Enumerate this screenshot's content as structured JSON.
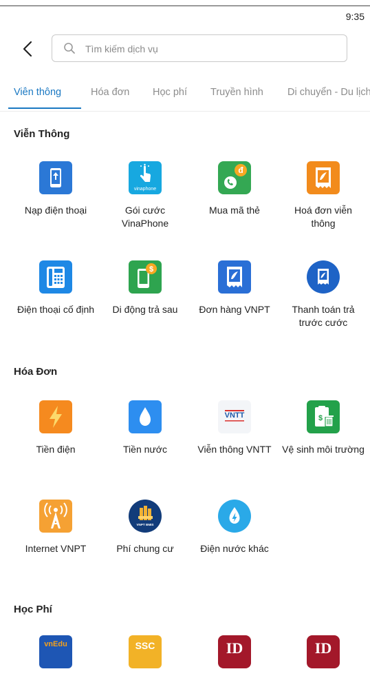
{
  "status": {
    "time": "9:35"
  },
  "search": {
    "placeholder": "Tìm kiếm dịch vụ"
  },
  "tabs": [
    {
      "label": "Viễn thông",
      "active": true
    },
    {
      "label": "Hóa đơn"
    },
    {
      "label": "Học phí"
    },
    {
      "label": "Truyền hình"
    },
    {
      "label": "Di chuyển - Du lịch"
    }
  ],
  "sections": {
    "vien_thong": {
      "title": "Viễn Thông",
      "items": [
        {
          "label": "Nạp điện thoại",
          "icon": "mobile-topup-icon"
        },
        {
          "label": "Gói cước VinaPhone",
          "icon": "vinaphone-package-icon",
          "icon_text": "vinaphone"
        },
        {
          "label": "Mua mã thẻ",
          "icon": "buy-card-code-icon",
          "icon_text": "đ"
        },
        {
          "label": "Hoá đơn viễn thông",
          "icon": "telecom-bill-icon"
        },
        {
          "label": "Điện thoại cố định",
          "icon": "landline-phone-icon"
        },
        {
          "label": "Di động trả sau",
          "icon": "postpaid-mobile-icon",
          "icon_text": "$"
        },
        {
          "label": "Đơn hàng VNPT",
          "icon": "vnpt-order-icon"
        },
        {
          "label": "Thanh toán trả trước cước",
          "icon": "prepaid-payment-icon"
        }
      ]
    },
    "hoa_don": {
      "title": "Hóa Đơn",
      "items": [
        {
          "label": "Tiền điện",
          "icon": "electricity-icon"
        },
        {
          "label": "Tiền nước",
          "icon": "water-drop-icon"
        },
        {
          "label": "Viễn thông VNTT",
          "icon": "vntt-logo-icon",
          "icon_text": "VNTT"
        },
        {
          "label": "Vệ sinh môi trường",
          "icon": "sanitation-icon",
          "icon_text": "$"
        },
        {
          "label": "Internet VNPT",
          "icon": "internet-tower-icon"
        },
        {
          "label": "Phí chung cư",
          "icon": "apartment-fee-icon",
          "icon_text": "VNPT BMIS"
        },
        {
          "label": "Điện nước khác",
          "icon": "other-utilities-icon"
        }
      ]
    },
    "hoc_phi": {
      "title": "Học Phí",
      "items": [
        {
          "label": "",
          "icon": "vnedu-icon",
          "icon_text": "vnEdu"
        },
        {
          "label": "",
          "icon": "ssc-icon",
          "icon_text": "SSC"
        },
        {
          "label": "",
          "icon": "id-school-icon",
          "icon_text": "ID"
        },
        {
          "label": "",
          "icon": "id-school-icon-2",
          "icon_text": "ID"
        }
      ]
    }
  },
  "colors": {
    "accent": "#1a78c2",
    "tab_inactive": "#8c8c8c",
    "orange": "#f28b1c",
    "green": "#2ea44f",
    "blue": "#2a7de1",
    "maroon": "#a3182a"
  }
}
